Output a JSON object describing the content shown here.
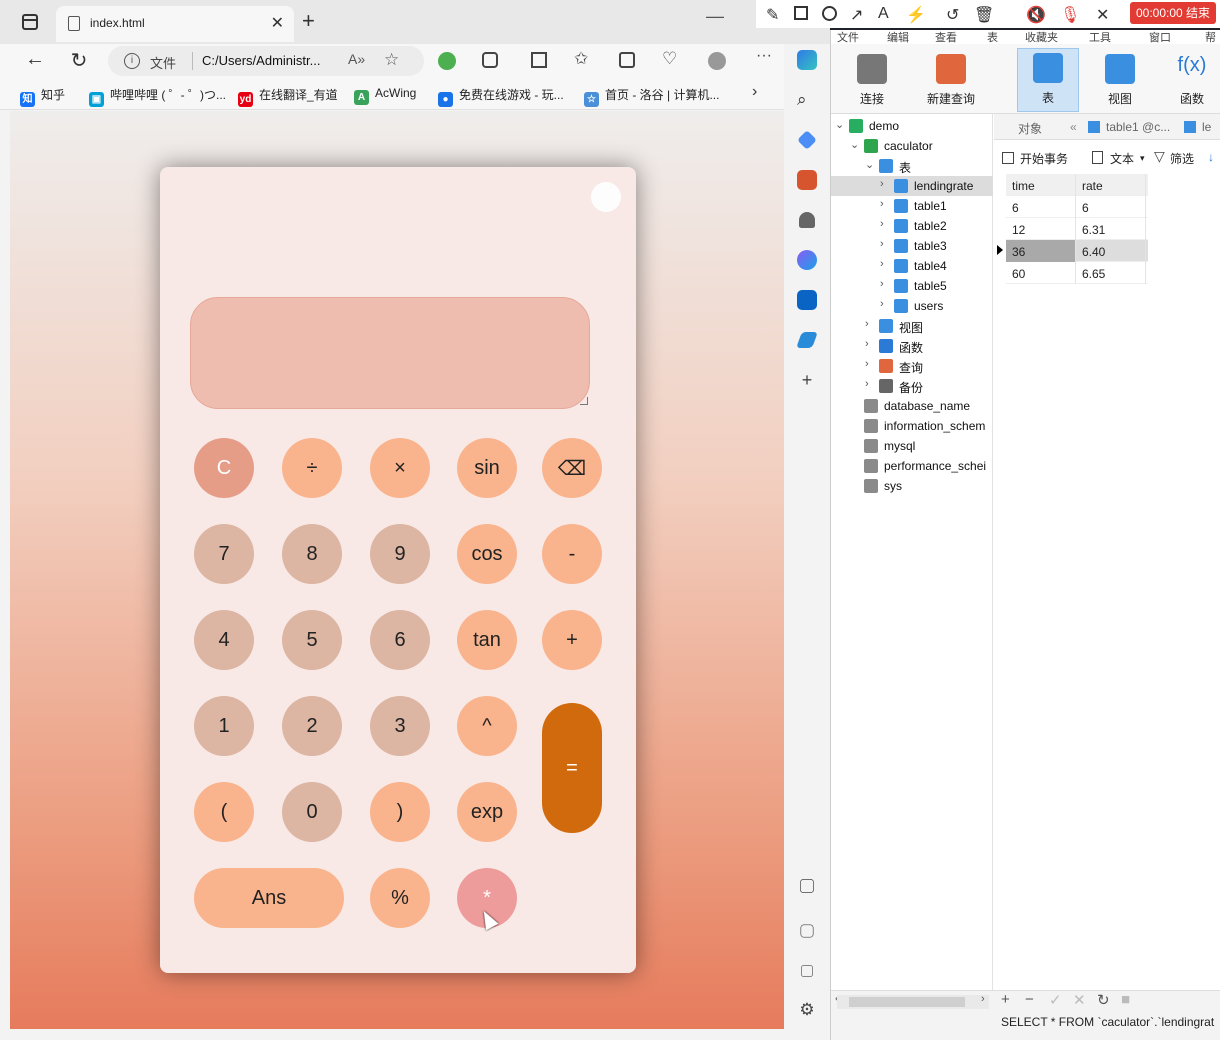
{
  "browser": {
    "tab_title": "index.html",
    "url_label": "文件",
    "url": "C:/Users/Administr...",
    "bookmarks": [
      {
        "label": "知乎",
        "color": "#1772f6",
        "glyph": "知"
      },
      {
        "label": "哔哩哔哩 ( ゜- ゜)つ...",
        "color": "#00a1d6",
        "glyph": "▣"
      },
      {
        "label": "在线翻译_有道",
        "color": "#e60012",
        "glyph": "yd"
      },
      {
        "label": "AcWing",
        "color": "#3aa35b",
        "glyph": "A"
      },
      {
        "label": "免费在线游戏 - 玩...",
        "color": "#1a73e8",
        "glyph": "●"
      },
      {
        "label": "首页 - 洛谷 | 计算机...",
        "color": "#4a90d9",
        "glyph": "☆"
      }
    ]
  },
  "calculator": {
    "display_value": "",
    "keys": [
      {
        "label": "C",
        "style": "clear"
      },
      {
        "label": "÷",
        "style": "op"
      },
      {
        "label": "×",
        "style": "op"
      },
      {
        "label": "sin",
        "style": "op"
      },
      {
        "label": "⌫",
        "style": "op"
      },
      {
        "label": "7",
        "style": "digit"
      },
      {
        "label": "8",
        "style": "digit"
      },
      {
        "label": "9",
        "style": "digit"
      },
      {
        "label": "cos",
        "style": "op"
      },
      {
        "label": "-",
        "style": "op"
      },
      {
        "label": "4",
        "style": "digit"
      },
      {
        "label": "5",
        "style": "digit"
      },
      {
        "label": "6",
        "style": "digit"
      },
      {
        "label": "tan",
        "style": "op"
      },
      {
        "label": "+",
        "style": "op"
      },
      {
        "label": "1",
        "style": "digit"
      },
      {
        "label": "2",
        "style": "digit"
      },
      {
        "label": "3",
        "style": "digit"
      },
      {
        "label": "^",
        "style": "op"
      },
      {
        "label": "=",
        "style": "eq"
      },
      {
        "label": "(",
        "style": "op"
      },
      {
        "label": "0",
        "style": "digit"
      },
      {
        "label": ")",
        "style": "op"
      },
      {
        "label": "exp",
        "style": "op"
      },
      {
        "label": "Ans",
        "style": "op-wide"
      },
      {
        "label": "%",
        "style": "op"
      },
      {
        "label": "*",
        "style": "star"
      }
    ]
  },
  "navicat": {
    "menu": [
      "文件",
      "编辑",
      "查看",
      "表",
      "收藏夹",
      "工具",
      "窗口",
      "帮助"
    ],
    "toolbar": [
      {
        "label": "连接"
      },
      {
        "label": "新建查询"
      },
      {
        "label": "表"
      },
      {
        "label": "视图"
      },
      {
        "label": "函数"
      }
    ],
    "tree": {
      "connection": "demo",
      "database": "caculator",
      "tables_group": "表",
      "tables": [
        "lendingrate",
        "table1",
        "table2",
        "table3",
        "table4",
        "table5",
        "users"
      ],
      "groups": [
        "视图",
        "函数",
        "查询",
        "备份"
      ],
      "other_dbs": [
        "database_name",
        "information_schem",
        "mysql",
        "performance_schei",
        "sys"
      ]
    },
    "object_tabs": [
      "对象",
      "table1 @c...",
      "le"
    ],
    "grid_toolbar": {
      "begin_tx": "开始事务",
      "text": "文本",
      "filter": "筛选"
    },
    "grid": {
      "columns": [
        "time",
        "rate"
      ],
      "rows": [
        [
          "6",
          "6"
        ],
        [
          "12",
          "6.31"
        ],
        [
          "36",
          "6.40"
        ],
        [
          "60",
          "6.65"
        ]
      ]
    },
    "status_sql": "SELECT * FROM `caculator`.`lendingrat"
  },
  "recorder": {
    "timer": "00:00:00 结束"
  }
}
